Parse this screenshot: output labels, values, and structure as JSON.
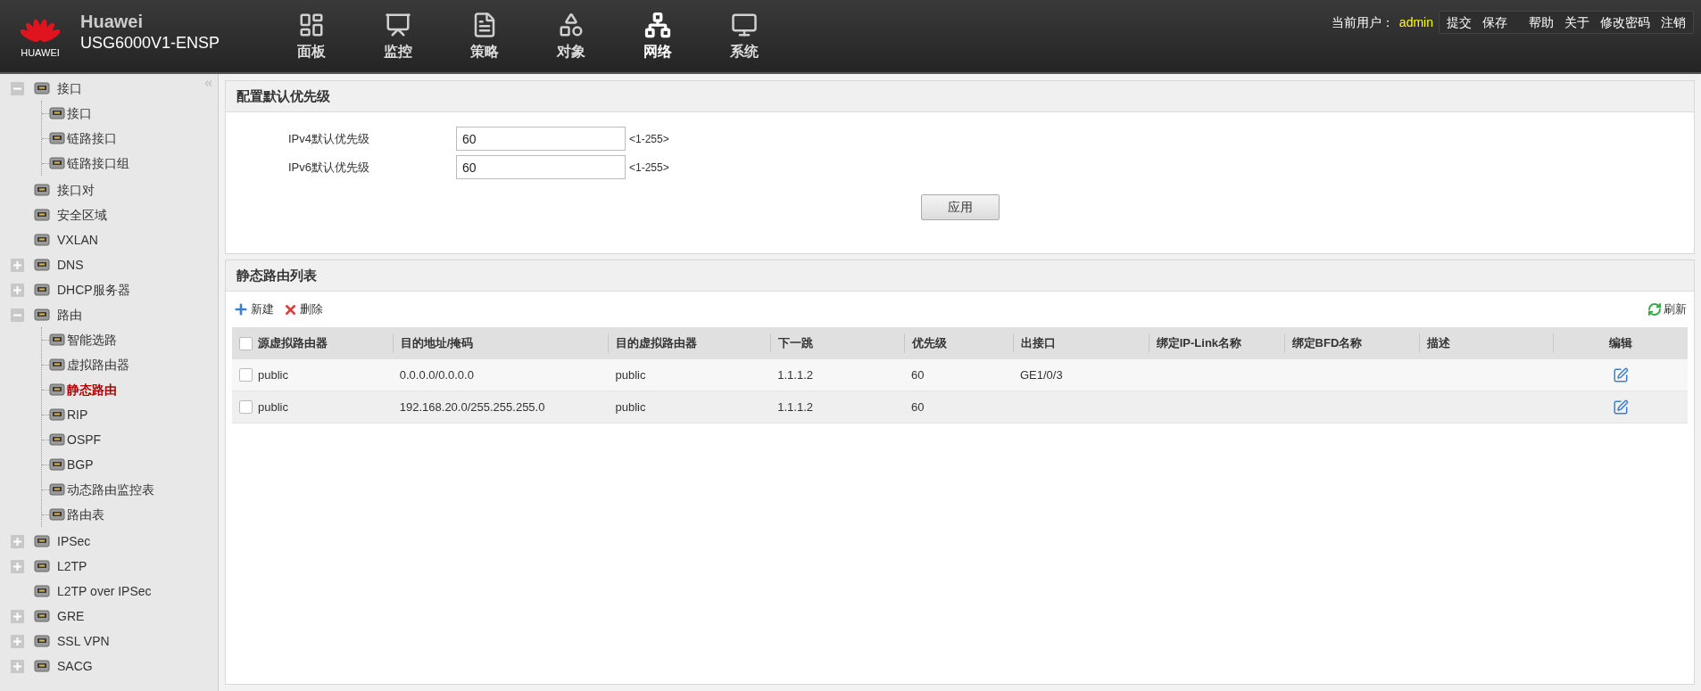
{
  "header": {
    "brand": "Huawei",
    "model": "USG6000V1-ENSP",
    "logo_text": "HUAWEI",
    "nav": [
      {
        "label": "面板",
        "selected": false
      },
      {
        "label": "监控",
        "selected": false
      },
      {
        "label": "策略",
        "selected": false
      },
      {
        "label": "对象",
        "selected": false
      },
      {
        "label": "网络",
        "selected": true
      },
      {
        "label": "系统",
        "selected": false
      }
    ],
    "user_label": "当前用户：",
    "user": "admin",
    "links": [
      "提交",
      "保存",
      "帮助",
      "关于",
      "修改密码",
      "注销"
    ]
  },
  "sidebar": {
    "items": [
      {
        "label": "接口",
        "expanded": true,
        "selected": false,
        "children": [
          {
            "label": "接口",
            "selected": false
          },
          {
            "label": "链路接口",
            "selected": false
          },
          {
            "label": "链路接口组",
            "selected": false
          }
        ]
      },
      {
        "label": "接口对",
        "selected": false
      },
      {
        "label": "安全区域",
        "selected": false
      },
      {
        "label": "VXLAN",
        "selected": false
      },
      {
        "label": "DNS",
        "expanded": false,
        "selected": false
      },
      {
        "label": "DHCP服务器",
        "expanded": false,
        "selected": false
      },
      {
        "label": "路由",
        "expanded": true,
        "selected": false,
        "children": [
          {
            "label": "智能选路",
            "selected": false
          },
          {
            "label": "虚拟路由器",
            "selected": false
          },
          {
            "label": "静态路由",
            "selected": true
          },
          {
            "label": "RIP",
            "selected": false
          },
          {
            "label": "OSPF",
            "selected": false
          },
          {
            "label": "BGP",
            "selected": false
          },
          {
            "label": "动态路由监控表",
            "selected": false
          },
          {
            "label": "路由表",
            "selected": false
          }
        ]
      },
      {
        "label": "IPSec",
        "expanded": false,
        "selected": false
      },
      {
        "label": "L2TP",
        "expanded": false,
        "selected": false
      },
      {
        "label": "L2TP over IPSec",
        "selected": false
      },
      {
        "label": "GRE",
        "expanded": false,
        "selected": false
      },
      {
        "label": "SSL VPN",
        "expanded": false,
        "selected": false
      },
      {
        "label": "SACG",
        "expanded": false,
        "selected": false
      }
    ]
  },
  "priority_panel": {
    "title": "配置默认优先级",
    "fields": [
      {
        "label": "IPv4默认优先级",
        "value": "60",
        "hint": "<1-255>"
      },
      {
        "label": "IPv6默认优先级",
        "value": "60",
        "hint": "<1-255>"
      }
    ],
    "apply_button": "应用"
  },
  "routes_panel": {
    "title": "静态路由列表",
    "toolbar": {
      "new": "新建",
      "delete": "删除",
      "refresh": "刷新"
    },
    "table": {
      "select_all_checked": false,
      "columns": [
        "源虚拟路由器",
        "目的地址/掩码",
        "目的虚拟路由器",
        "下一跳",
        "优先级",
        "出接口",
        "绑定IP-Link名称",
        "绑定BFD名称",
        "描述",
        "编辑"
      ],
      "rows": [
        {
          "checked": false,
          "cells": [
            "public",
            "0.0.0.0/0.0.0.0",
            "public",
            "1.1.1.2",
            "60",
            "GE1/0/3",
            "",
            "",
            ""
          ]
        },
        {
          "checked": false,
          "cells": [
            "public",
            "192.168.20.0/255.255.255.0",
            "public",
            "1.1.1.2",
            "60",
            "",
            "",
            "",
            ""
          ]
        }
      ]
    }
  }
}
